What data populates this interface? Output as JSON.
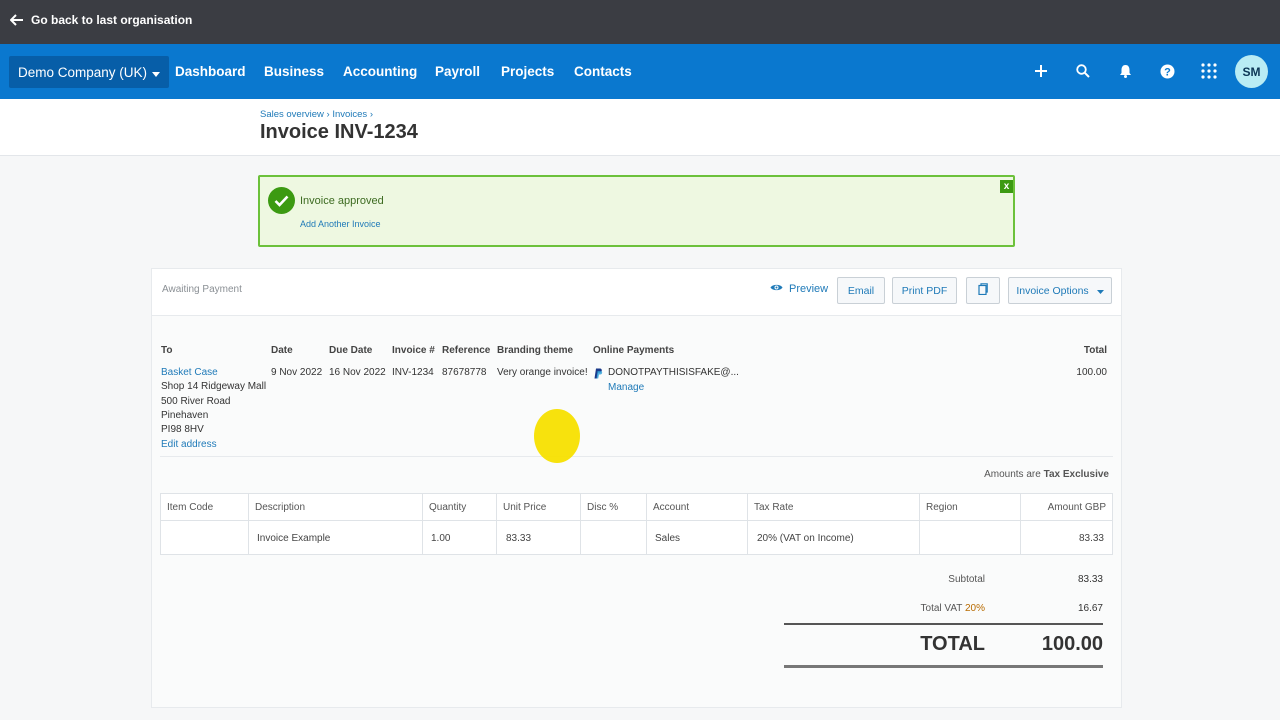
{
  "topbar": {
    "back_label": "Go back to last organisation"
  },
  "nav": {
    "org": "Demo Company (UK)",
    "items": [
      "Dashboard",
      "Business",
      "Accounting",
      "Payroll",
      "Projects",
      "Contacts"
    ],
    "icons": [
      "plus-icon",
      "search-icon",
      "bell-icon",
      "help-icon",
      "apps-grid-icon"
    ],
    "avatar": "SM"
  },
  "header": {
    "breadcrumb": "Sales overview › Invoices ›",
    "title": "Invoice INV-1234"
  },
  "alert": {
    "title": "Invoice approved",
    "link": "Add Another Invoice",
    "close": "x"
  },
  "card": {
    "status": "Awaiting Payment",
    "preview": "Preview",
    "email": "Email",
    "print_pdf": "Print PDF",
    "invoice_options": "Invoice Options"
  },
  "details": {
    "labels": {
      "to": "To",
      "date": "Date",
      "due_date": "Due Date",
      "invoice_no": "Invoice #",
      "reference": "Reference",
      "branding": "Branding theme",
      "online_payments": "Online Payments",
      "total": "Total"
    },
    "contact": "Basket Case",
    "address": [
      "Shop 14 Ridgeway Mall",
      "500 River Road",
      "Pinehaven",
      "PI98 8HV"
    ],
    "edit_address": "Edit address",
    "date": "9 Nov 2022",
    "due_date": "16 Nov 2022",
    "invoice_no": "INV-1234",
    "reference": "87678778",
    "branding": "Very orange invoice!",
    "payment_account": "DONOTPAYTHISISFAKE@...",
    "manage": "Manage",
    "total": "100.00"
  },
  "amounts_note": {
    "prefix": "Amounts are",
    "value": "Tax Exclusive"
  },
  "line_items": {
    "headers": [
      "Item Code",
      "Description",
      "Quantity",
      "Unit Price",
      "Disc %",
      "Account",
      "Tax Rate",
      "Region",
      "Amount GBP"
    ],
    "row": [
      "",
      "Invoice Example",
      "1.00",
      "83.33",
      "",
      "Sales",
      "20% (VAT on Income)",
      "",
      "83.33"
    ]
  },
  "totals": {
    "subtotal_label": "Subtotal",
    "subtotal": "83.33",
    "vat_label": "Total VAT",
    "vat_rate": "20%",
    "vat": "16.67",
    "total_label": "TOTAL",
    "total": "100.00"
  }
}
